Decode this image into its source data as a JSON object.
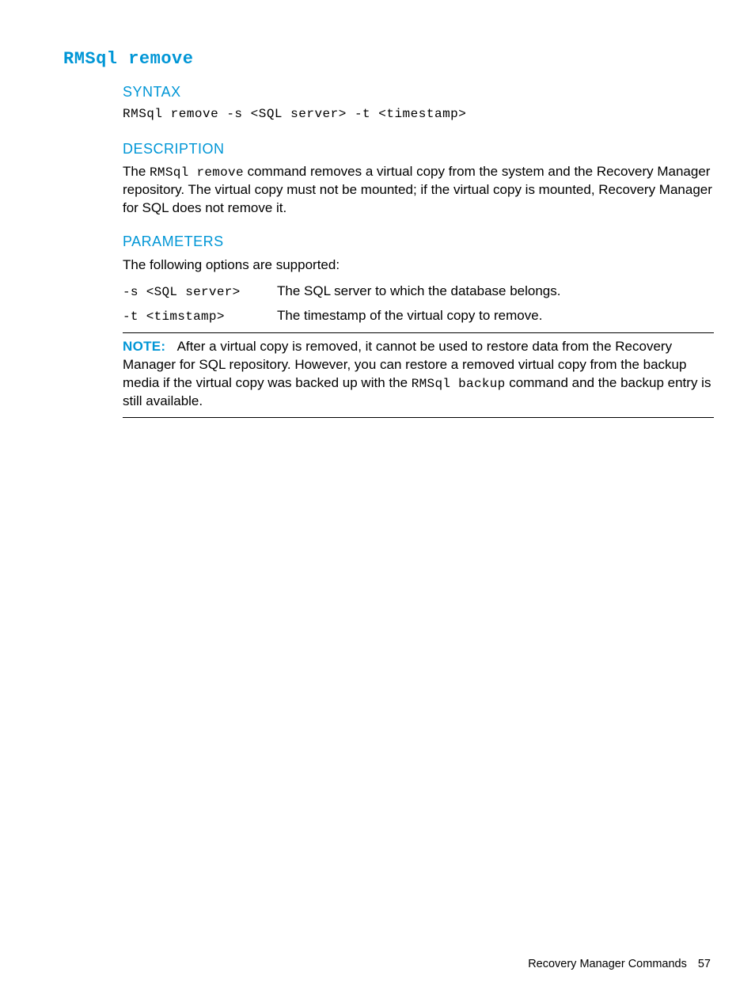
{
  "title": "RMSql remove",
  "sections": {
    "syntax": {
      "heading": "SYNTAX",
      "line": "RMSql remove -s <SQL server> -t <timestamp>"
    },
    "description": {
      "heading": "DESCRIPTION",
      "pre": "The ",
      "cmd": "RMSql remove",
      "post": " command removes a virtual copy from the system and the Recovery Manager repository. The virtual copy must not be mounted; if the virtual copy is mounted, Recovery Manager for SQL does not remove it."
    },
    "parameters": {
      "heading": "PARAMETERS",
      "intro": "The following options are supported:",
      "rows": [
        {
          "opt": "-s <SQL server>",
          "desc": "The SQL server to which the database belongs."
        },
        {
          "opt": "-t <timstamp>",
          "desc": "The timestamp of the virtual copy to remove."
        }
      ]
    },
    "note": {
      "label": "NOTE:",
      "pre": "After a virtual copy is removed, it cannot be used to restore data from the Recovery Manager for SQL repository. However, you can restore a removed virtual copy from the backup media if the virtual copy was backed up with the ",
      "cmd": "RMSql backup",
      "post": " command and the backup entry is still available."
    }
  },
  "footer": {
    "text": "Recovery Manager Commands",
    "page": "57"
  }
}
